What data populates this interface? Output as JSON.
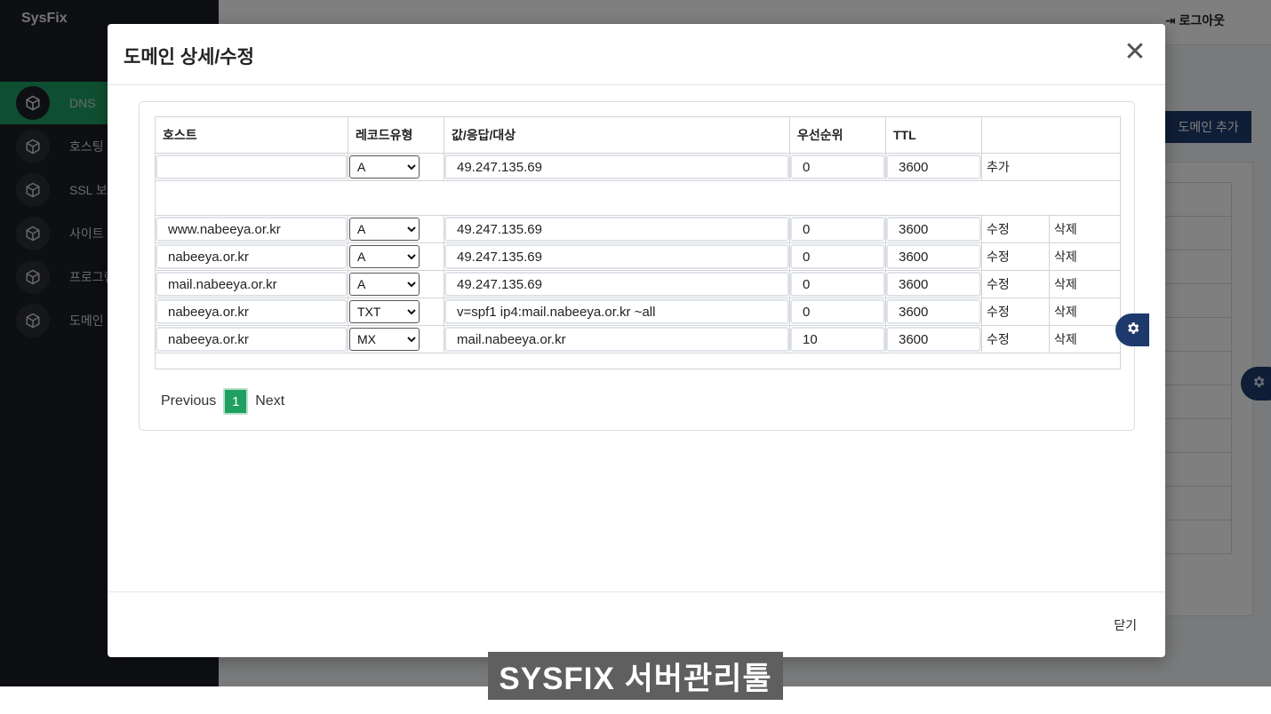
{
  "app": {
    "brand": "SysFix",
    "logout_label": "로그아웃",
    "add_domain_label": "도메인 추가",
    "sidebar": [
      {
        "label": "DNS",
        "active": true
      },
      {
        "label": "호스팅"
      },
      {
        "label": "SSL 보안"
      },
      {
        "label": "사이트"
      },
      {
        "label": "프로그램"
      },
      {
        "label": "도메인"
      }
    ]
  },
  "modal": {
    "title": "도메인 상세/수정",
    "close_symbol": "✕",
    "columns": [
      "호스트",
      "레코드유형",
      "값/응답/대상",
      "우선순위",
      "TTL"
    ],
    "new_record": {
      "host": "",
      "type": "A",
      "value": "49.247.135.69",
      "priority": "0",
      "ttl": "3600",
      "add_label": "추가"
    },
    "edit_label": "수정",
    "delete_label": "삭제",
    "records": [
      {
        "host": "www.nabeeya.or.kr",
        "type": "A",
        "value": "49.247.135.69",
        "priority": "0",
        "ttl": "3600"
      },
      {
        "host": "nabeeya.or.kr",
        "type": "A",
        "value": "49.247.135.69",
        "priority": "0",
        "ttl": "3600"
      },
      {
        "host": "mail.nabeeya.or.kr",
        "type": "A",
        "value": "49.247.135.69",
        "priority": "0",
        "ttl": "3600"
      },
      {
        "host": "nabeeya.or.kr",
        "type": "TXT",
        "value": "v=spf1 ip4:mail.nabeeya.or.kr ~all",
        "priority": "0",
        "ttl": "3600"
      },
      {
        "host": "nabeeya.or.kr",
        "type": "MX",
        "value": "mail.nabeeya.or.kr",
        "priority": "10",
        "ttl": "3600"
      }
    ],
    "pagination": {
      "prev": "Previous",
      "current": "1",
      "next": "Next"
    },
    "footer_close": "닫기"
  },
  "caption": "SYSFIX 서버관리툴",
  "colors": {
    "accent": "#1f9f62",
    "navy": "#1e3a6d",
    "sidebar": "#1b1e24"
  }
}
